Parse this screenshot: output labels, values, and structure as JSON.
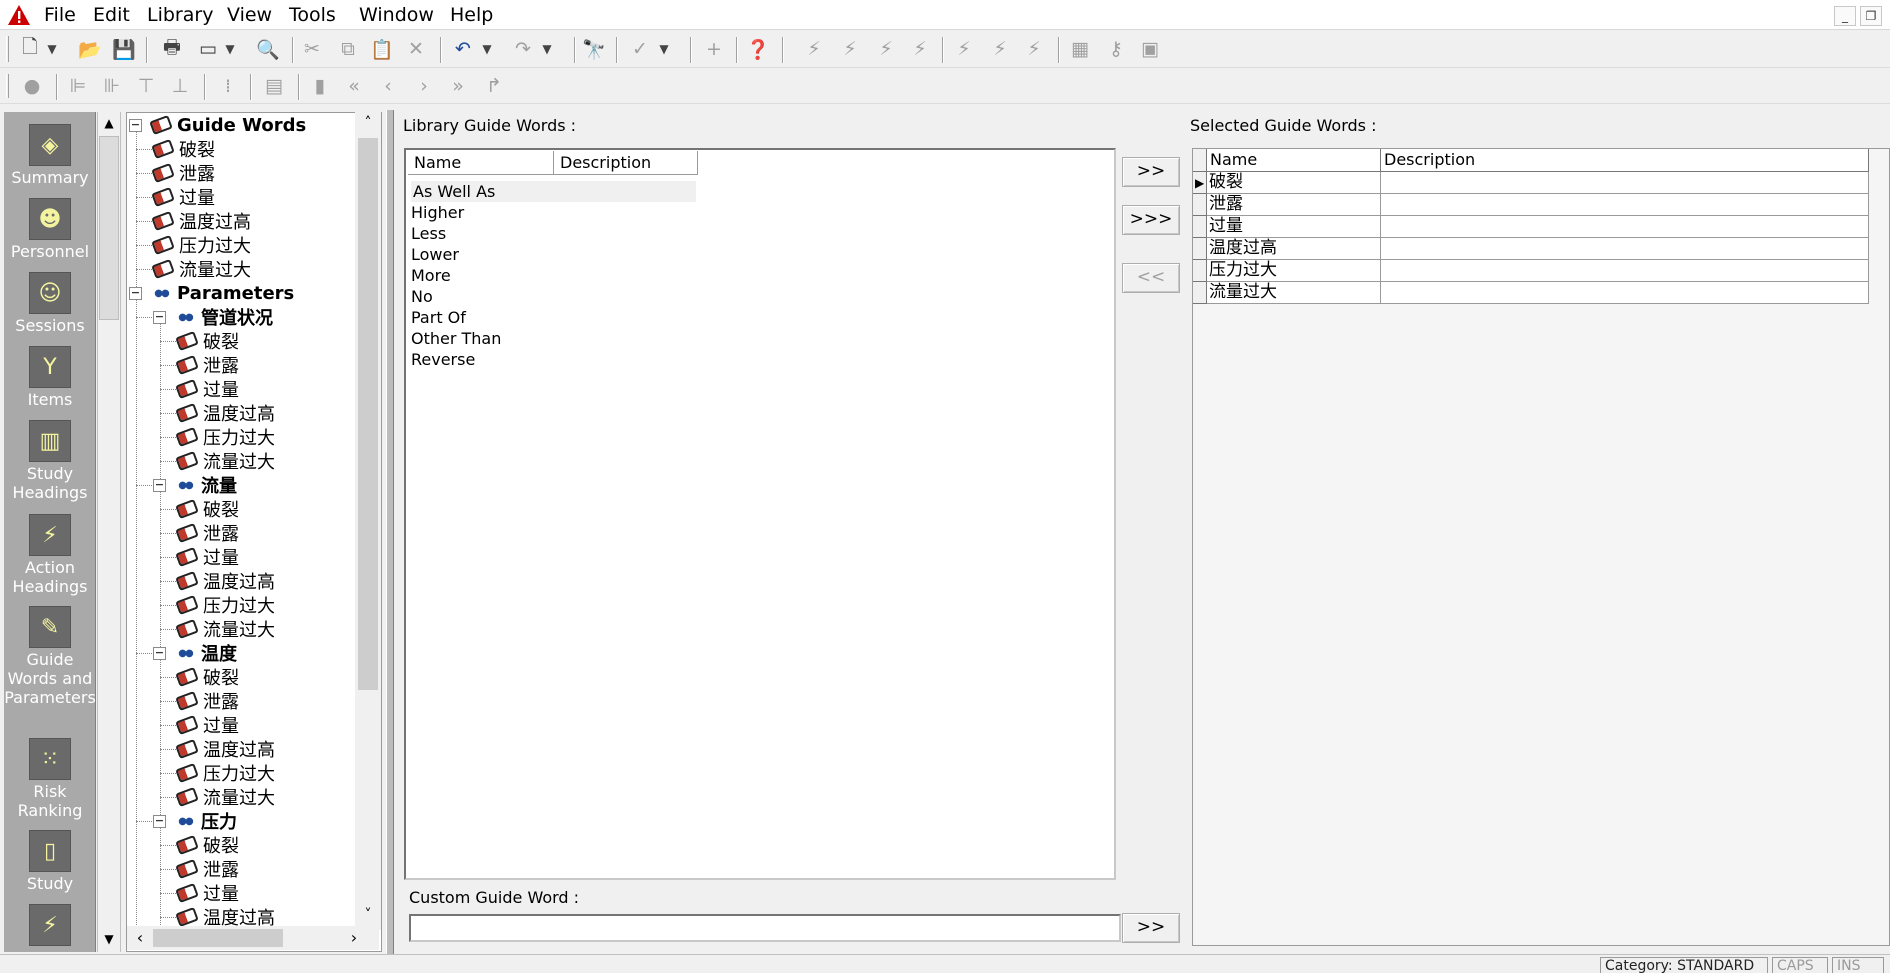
{
  "menubar": {
    "items": [
      "File",
      "Edit",
      "Library",
      "View",
      "Tools",
      "Window",
      "Help"
    ]
  },
  "window_controls": {
    "minimize": "_",
    "restore": "❐"
  },
  "navbar": {
    "items": [
      {
        "label": "Summary",
        "icon": "summary-icon"
      },
      {
        "label": "Personnel",
        "icon": "personnel-icon"
      },
      {
        "label": "Sessions",
        "icon": "sessions-icon"
      },
      {
        "label": "Items",
        "icon": "items-icon"
      },
      {
        "label": "Study Headings",
        "icon": "study-headings-icon"
      },
      {
        "label": "Action Headings",
        "icon": "action-headings-icon"
      },
      {
        "label": "Guide Words and Parameters",
        "icon": "guide-words-parameters-icon"
      },
      {
        "label": "Risk Ranking",
        "icon": "risk-ranking-icon"
      },
      {
        "label": "Study",
        "icon": "study-icon"
      }
    ]
  },
  "tree": {
    "root_guide_words": "Guide Words",
    "guide_words": [
      "破裂",
      "泄露",
      "过量",
      "温度过高",
      "压力过大",
      "流量过大"
    ],
    "root_parameters": "Parameters",
    "parameters": [
      {
        "name": "管道状况",
        "children": [
          "破裂",
          "泄露",
          "过量",
          "温度过高",
          "压力过大",
          "流量过大"
        ]
      },
      {
        "name": "流量",
        "children": [
          "破裂",
          "泄露",
          "过量",
          "温度过高",
          "压力过大",
          "流量过大"
        ]
      },
      {
        "name": "温度",
        "children": [
          "破裂",
          "泄露",
          "过量",
          "温度过高",
          "压力过大",
          "流量过大"
        ]
      },
      {
        "name": "压力",
        "children": [
          "破裂",
          "泄露",
          "过量",
          "温度过高"
        ]
      }
    ]
  },
  "library": {
    "label": "Library Guide Words :",
    "columns": [
      "Name",
      "Description"
    ],
    "rows": [
      "As Well As",
      "Higher",
      "Less",
      "Lower",
      "More",
      "No",
      "Part Of",
      "Other Than",
      "Reverse"
    ]
  },
  "transfer_buttons": {
    "add": ">>",
    "add_all": ">>>",
    "remove": "<<",
    "add_custom": ">>"
  },
  "selected": {
    "label": "Selected Guide Words :",
    "columns": [
      "Name",
      "Description"
    ],
    "rows": [
      "破裂",
      "泄露",
      "过量",
      "温度过高",
      "压力过大",
      "流量过大"
    ]
  },
  "custom": {
    "label": "Custom Guide Word :",
    "value": ""
  },
  "statusbar": {
    "category": "Category: STANDARD",
    "caps": "CAPS",
    "ins": "INS"
  },
  "colors": {
    "navbar_bg": "#a9a9a9",
    "app_icon": "#cc0000"
  }
}
